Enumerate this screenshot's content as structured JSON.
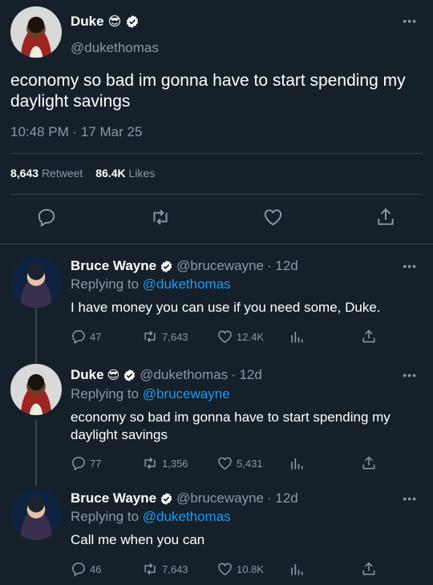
{
  "main_tweet": {
    "display_name": "Duke",
    "emoji": "😎",
    "handle": "@dukethomas",
    "more": "•••",
    "text": "economy so bad im gonna have to start spending my daylight savings",
    "timestamp": "10:48 PM · 17 Mar 25",
    "retweets_count": "8,643",
    "retweets_label": "Retweet",
    "likes_count": "86.4K",
    "likes_label": "Likes"
  },
  "replies": [
    {
      "display_name": "Bruce Wayne",
      "handle": "@brucewayne",
      "time": "· 12d",
      "replying_label": "Replying to",
      "replying_to": "@dukethomas",
      "text": "I have money you can use if you need some, Duke.",
      "replies": "47",
      "retweets": "7,643",
      "likes": "12.4K",
      "avatar": "bruce"
    },
    {
      "display_name": "Duke",
      "emoji": "😎",
      "handle": "@dukethomas",
      "time": "· 12d",
      "replying_label": "Replying to",
      "replying_to": "@brucewayne",
      "text": "economy so bad im gonna have to start spending my daylight savings",
      "replies": "77",
      "retweets": "1,356",
      "likes": "5,431",
      "avatar": "duke"
    },
    {
      "display_name": "Bruce Wayne",
      "handle": "@brucewayne",
      "time": "· 12d",
      "replying_label": "Replying to",
      "replying_to": "@dukethomas",
      "text": "Call me when you can",
      "replies": "46",
      "retweets": "7,643",
      "likes": "10.8K",
      "avatar": "bruce"
    }
  ],
  "icons": {
    "verified": "verified-badge-icon",
    "reply": "reply-icon",
    "retweet": "retweet-icon",
    "like": "heart-icon",
    "share": "share-icon",
    "analytics": "analytics-icon",
    "more": "more-icon"
  },
  "colors": {
    "background": "#15202b",
    "muted": "#8b98a5",
    "link": "#1d9bf0",
    "divider": "#38444d"
  }
}
